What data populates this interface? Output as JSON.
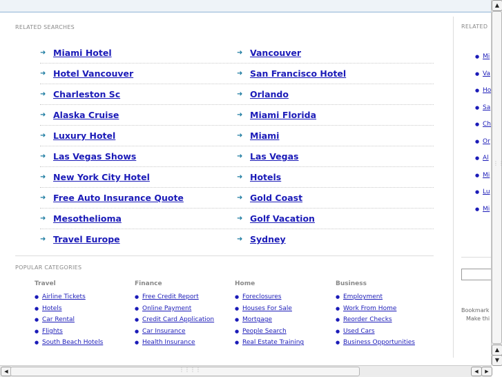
{
  "related_searches": {
    "title": "RELATED SEARCHES",
    "left": [
      "Miami Hotel",
      "Hotel Vancouver",
      "Charleston Sc",
      "Alaska Cruise",
      "Luxury Hotel",
      "Las Vegas Shows",
      "New York City Hotel",
      "Free Auto Insurance Quote",
      "Mesothelioma",
      "Travel Europe"
    ],
    "right": [
      "Vancouver",
      "San Francisco Hotel",
      "Orlando",
      "Miami Florida",
      "Miami",
      "Las Vegas",
      "Hotels",
      "Gold Coast",
      "Golf Vacation",
      "Sydney"
    ]
  },
  "popular_categories": {
    "title": "POPULAR CATEGORIES",
    "columns": [
      {
        "heading": "Travel",
        "items": [
          "Airline Tickets",
          "Hotels",
          "Car Rental",
          "Flights",
          "South Beach Hotels"
        ]
      },
      {
        "heading": "Finance",
        "items": [
          "Free Credit Report",
          "Online Payment",
          "Credit Card Application",
          "Car Insurance",
          "Health Insurance"
        ]
      },
      {
        "heading": "Home",
        "items": [
          "Foreclosures",
          "Houses For Sale",
          "Mortgage",
          "People Search",
          "Real Estate Training"
        ]
      },
      {
        "heading": "Business",
        "items": [
          "Employment",
          "Work From Home",
          "Reorder Checks",
          "Used Cars",
          "Business Opportunities"
        ]
      }
    ]
  },
  "right_panel": {
    "title": "RELATED",
    "items": [
      "Mi",
      "Va",
      "Ho",
      "Sa",
      "Ch",
      "Or",
      "Al",
      "Mi",
      "Lu",
      "Mi"
    ],
    "bookmark_line1": "Bookmark",
    "bookmark_line2": "Make thi"
  },
  "icons": {
    "arrow": "arrow-right-icon",
    "bullet": "bullet-icon"
  }
}
